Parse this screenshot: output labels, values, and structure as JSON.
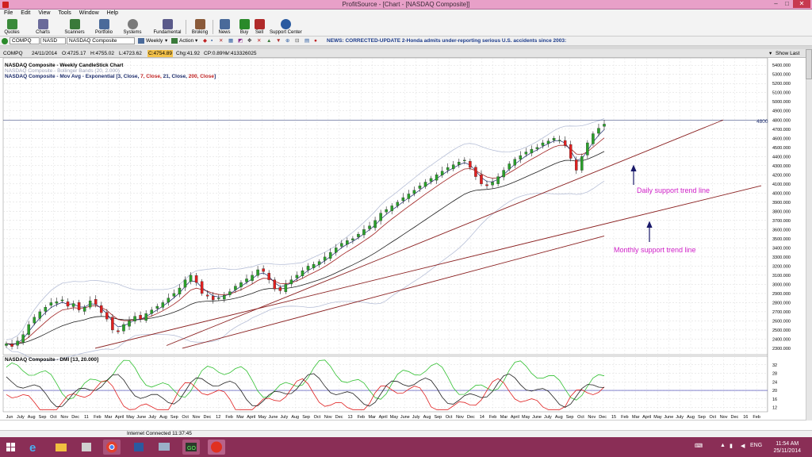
{
  "window": {
    "title": "ProfitSource - [Chart -  [NASDAQ Composite]]",
    "min": "–",
    "max": "□",
    "close": "✕"
  },
  "menu": [
    "File",
    "Edit",
    "View",
    "Tools",
    "Window",
    "Help"
  ],
  "toolbar": [
    {
      "label": "Quotes",
      "icon": "quotes-icon",
      "color": "#3a8a3a"
    },
    {
      "label": "Charts",
      "icon": "charts-icon",
      "color": "#6a6a9a"
    },
    {
      "label": "Scanners",
      "icon": "scanners-icon",
      "color": "#3a7a3a"
    },
    {
      "label": "Portfolio",
      "icon": "portfolio-icon",
      "color": "#4a6a9a"
    },
    {
      "label": "Systems",
      "icon": "systems-icon",
      "color": "#7a7a7a"
    },
    {
      "label": "Fundamental",
      "icon": "fundamental-icon",
      "color": "#5a5a8a"
    },
    {
      "label": "Broking",
      "icon": "broking-icon",
      "color": "#8a5a3a"
    },
    {
      "label": "News",
      "icon": "news-icon",
      "color": "#4a6a9a"
    },
    {
      "label": "Buy",
      "icon": "buy-icon",
      "color": "#2a8a2a"
    },
    {
      "label": "Sell",
      "icon": "sell-icon",
      "color": "#b02a2a"
    },
    {
      "label": "Support Center",
      "icon": "help-icon",
      "color": "#2a5aa0"
    }
  ],
  "symbar": {
    "symbol": "COMPQ",
    "exchange": "NASD",
    "name": "NASDAQ Composite",
    "period": "Weekly",
    "action": "Action",
    "news": "NEWS: CORRECTED-UPDATE 2-Honda admits under-reporting serious U.S. accidents since 2003:"
  },
  "quote": {
    "symbol": "COMPQ",
    "date": "24/11/2014",
    "open": "O:4725.17",
    "high": "H:4755.02",
    "low": "L:4723.62",
    "close": "C:4754.89",
    "change": "Chg:41.92",
    "changepct": "CP:0.89%",
    "volume": "V:413326025",
    "show_last": "Show Last"
  },
  "legend": {
    "line1": "NASDAQ Composite - Weekly CandleStick Chart",
    "line2": "NASDAQ Composite - Bollinger Bands (20, 2.000)",
    "line3a": "NASDAQ Composite - Mov Avg - Exponential [3, Close, ",
    "line3b": "7, Close,",
    "line3c": " 21, Close, ",
    "line3d": "200, Close",
    "line3e": "]",
    "dmi": "NASDAQ Composite - DMI [13, 20.000]"
  },
  "annotations": {
    "daily": "Daily support trend line",
    "monthly": "Monthly support trend line",
    "hline_label": "4800"
  },
  "yaxis_price": [
    "5400.000",
    "5300.000",
    "5200.000",
    "5100.000",
    "5000.000",
    "4900.000",
    "4800.000",
    "4700.000",
    "4600.000",
    "4500.000",
    "4400.000",
    "4300.000",
    "4200.000",
    "4100.000",
    "4000.000",
    "3900.000",
    "3800.000",
    "3700.000",
    "3600.000",
    "3500.000",
    "3400.000",
    "3300.000",
    "3200.000",
    "3100.000",
    "3000.000",
    "2900.000",
    "2800.000",
    "2700.000",
    "2600.000",
    "2500.000",
    "2400.000",
    "2300.000"
  ],
  "yaxis_dmi": [
    "32",
    "28",
    "24",
    "20",
    "16",
    "12"
  ],
  "xaxis": [
    "Jun",
    "July",
    "Aug",
    "Sep",
    "Oct",
    "Nov",
    "Dec",
    "11",
    "Feb",
    "Mar",
    "April",
    "May",
    "June",
    "July",
    "Aug",
    "Sep",
    "Oct",
    "Nov",
    "Dec",
    "12",
    "Feb",
    "Mar",
    "April",
    "May",
    "June",
    "July",
    "Aug",
    "Sep",
    "Oct",
    "Nov",
    "Dec",
    "13",
    "Feb",
    "Mar",
    "April",
    "May",
    "June",
    "July",
    "Aug",
    "Sep",
    "Oct",
    "Nov",
    "Dec",
    "14",
    "Feb",
    "Mar",
    "April",
    "May",
    "June",
    "July",
    "Aug",
    "Sep",
    "Oct",
    "Nov",
    "Dec",
    "15",
    "Feb",
    "Mar",
    "April",
    "May",
    "June",
    "July",
    "Aug",
    "Sep",
    "Oct",
    "Nov",
    "Dec",
    "16",
    "Feb"
  ],
  "status": "Internet Connected 11:37:45",
  "taskbar": {
    "lang": "ENG",
    "time": "11:54 AM",
    "date": "25/11/2014"
  },
  "chart_data": {
    "type": "line",
    "title": "NASDAQ Composite - Weekly CandleStick Chart",
    "ylim": [
      2230,
      5480
    ],
    "dmi_ylim": [
      10,
      36
    ],
    "close_series": [
      2350,
      2320,
      2380,
      2450,
      2560,
      2640,
      2700,
      2750,
      2800,
      2810,
      2830,
      2760,
      2790,
      2720,
      2750,
      2820,
      2780,
      2690,
      2620,
      2500,
      2480,
      2560,
      2600,
      2650,
      2620,
      2680,
      2720,
      2760,
      2800,
      2850,
      2900,
      2960,
      3050,
      3100,
      3020,
      2900,
      2870,
      2830,
      2850,
      2880,
      2920,
      2980,
      3020,
      3060,
      3100,
      3160,
      3140,
      3050,
      2950,
      2930,
      3000,
      3050,
      3100,
      3150,
      3200,
      3220,
      3250,
      3300,
      3350,
      3400,
      3450,
      3480,
      3500,
      3550,
      3600,
      3640,
      3700,
      3780,
      3820,
      3860,
      3900,
      3950,
      3990,
      4030,
      4080,
      4120,
      4160,
      4200,
      4240,
      4280,
      4310,
      4340,
      4360,
      4280,
      4180,
      4100,
      4080,
      4120,
      4180,
      4250,
      4320,
      4370,
      4410,
      4450,
      4480,
      4500,
      4550,
      4570,
      4600,
      4580,
      4520,
      4380,
      4250,
      4400,
      4550,
      4650,
      4710,
      4755
    ],
    "trendlines": [
      {
        "name": "Daily support trend line",
        "from": [
          2010.37,
          2300
        ],
        "to": [
          2015.2,
          4820
        ]
      },
      {
        "name": "Monthly support trend line",
        "from": [
          2011.6,
          2300
        ],
        "to": [
          2015.7,
          4100
        ]
      }
    ],
    "hline": 4800
  }
}
